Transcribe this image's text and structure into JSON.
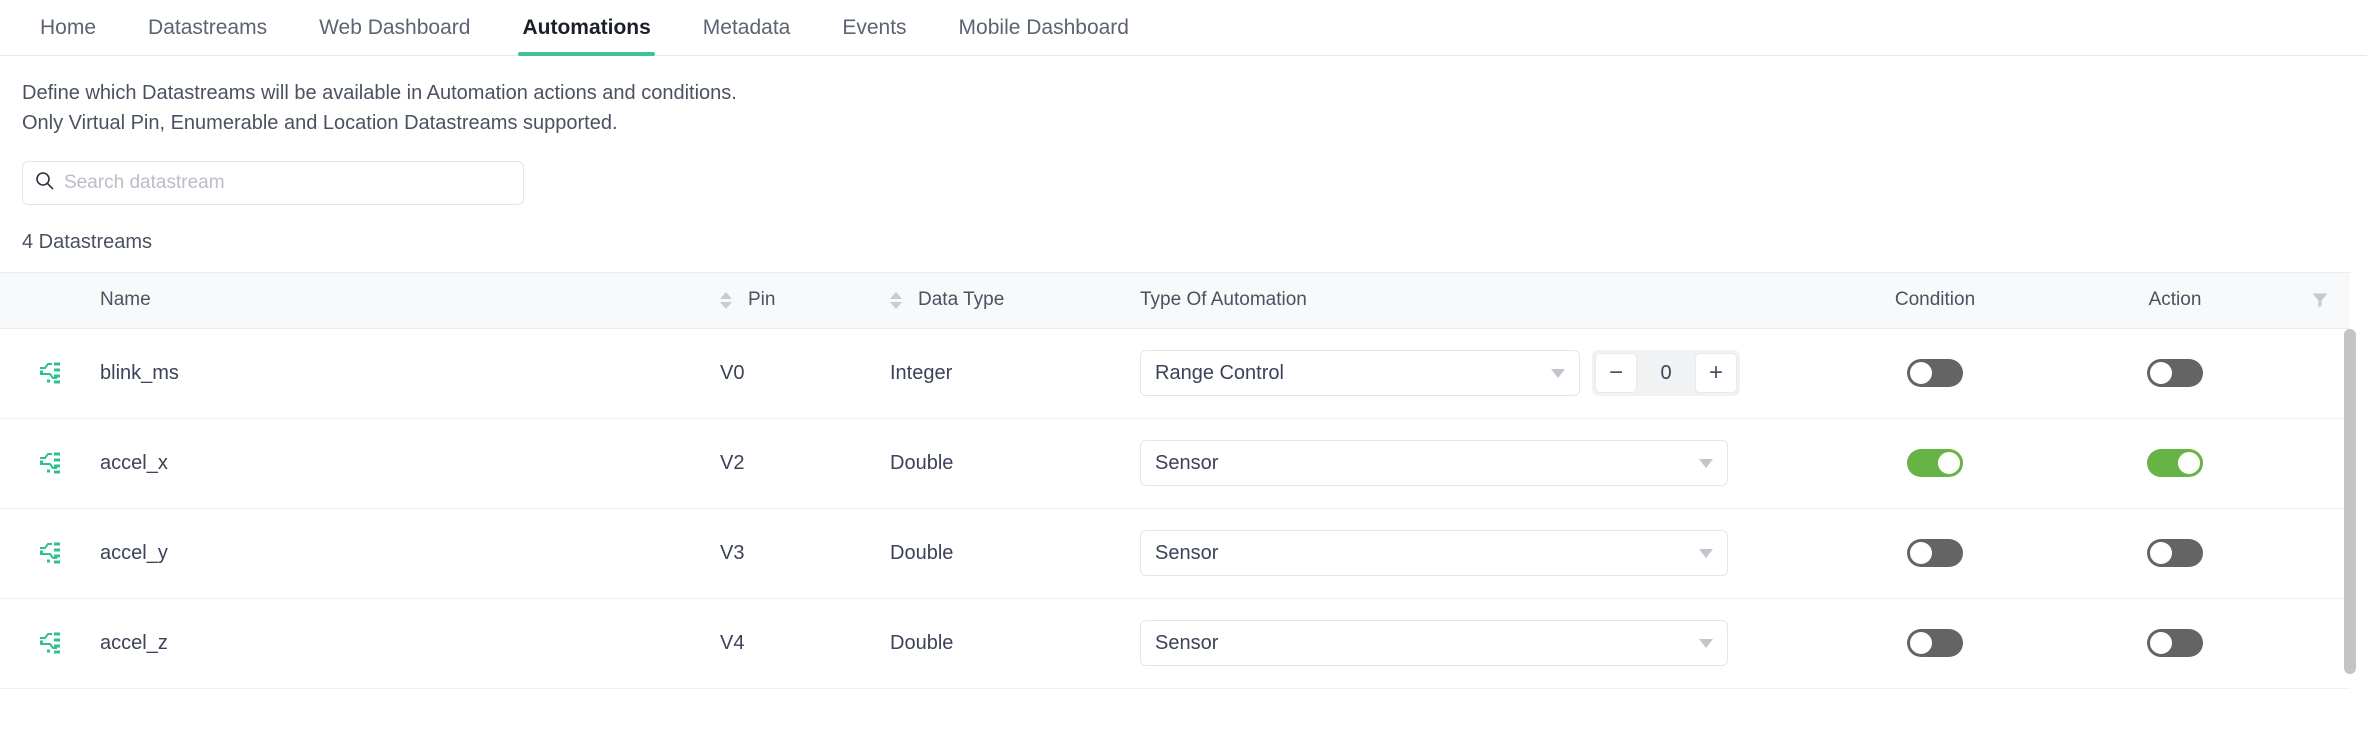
{
  "nav": {
    "tabs": [
      {
        "label": "Home",
        "active": false
      },
      {
        "label": "Datastreams",
        "active": false
      },
      {
        "label": "Web Dashboard",
        "active": false
      },
      {
        "label": "Automations",
        "active": true
      },
      {
        "label": "Metadata",
        "active": false
      },
      {
        "label": "Events",
        "active": false
      },
      {
        "label": "Mobile Dashboard",
        "active": false
      }
    ]
  },
  "description": {
    "line1": "Define which Datastreams will be available in Automation actions and conditions.",
    "line2": "Only Virtual Pin, Enumerable and Location Datastreams supported."
  },
  "search": {
    "placeholder": "Search datastream",
    "value": "",
    "icon": "search-icon"
  },
  "summary": {
    "count_label": "4 Datastreams"
  },
  "table": {
    "headers": {
      "icon": "",
      "name": "Name",
      "pin": "Pin",
      "data_type": "Data Type",
      "type_of_automation": "Type Of Automation",
      "condition": "Condition",
      "action": "Action",
      "filter_icon": "filter-icon"
    },
    "rows": [
      {
        "icon": "datastream-icon",
        "name": "blink_ms",
        "pin": "V0",
        "data_type": "Integer",
        "automation_type": "Range Control",
        "has_stepper": true,
        "stepper": {
          "decrement": "−",
          "value": "0",
          "increment": "+"
        },
        "condition_on": false,
        "action_on": false
      },
      {
        "icon": "datastream-icon",
        "name": "accel_x",
        "pin": "V2",
        "data_type": "Double",
        "automation_type": "Sensor",
        "has_stepper": false,
        "condition_on": true,
        "action_on": true
      },
      {
        "icon": "datastream-icon",
        "name": "accel_y",
        "pin": "V3",
        "data_type": "Double",
        "automation_type": "Sensor",
        "has_stepper": false,
        "condition_on": false,
        "action_on": false
      },
      {
        "icon": "datastream-icon",
        "name": "accel_z",
        "pin": "V4",
        "data_type": "Double",
        "automation_type": "Sensor",
        "has_stepper": false,
        "condition_on": false,
        "action_on": false
      }
    ]
  },
  "colors": {
    "accent_green": "#3fc294",
    "toggle_on": "#66b346",
    "toggle_off": "#646464",
    "header_bg": "#f8f9fa"
  }
}
